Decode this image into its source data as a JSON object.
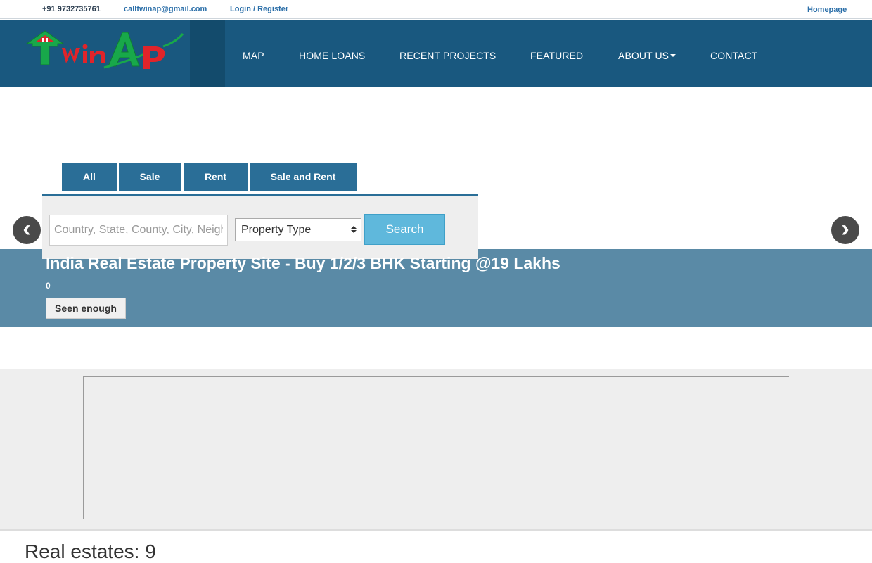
{
  "topbar": {
    "phone": "+91 9732735761",
    "email": "calltwinap@gmail.com",
    "login": "Login / Register",
    "homepage": "Homepage"
  },
  "logo": {
    "text": "TwinAp"
  },
  "nav": {
    "map": "MAP",
    "home_loans": "HOME LOANS",
    "recent_projects": "RECENT PROJECTS",
    "featured": "FEATURED",
    "about_us": "ABOUT US",
    "contact": "CONTACT"
  },
  "tabs": {
    "all": "All",
    "sale": "Sale",
    "rent": "Rent",
    "sale_and_rent": "Sale and Rent"
  },
  "search": {
    "placeholder": "Country, State, County, City, Neighborhood",
    "type_selected": "Property Type",
    "button": "Search"
  },
  "slider": {
    "prev": "‹",
    "next": "›",
    "title": "India Real Estate Property Site - Buy 1/2/3 BHK Starting @19 Lakhs",
    "count": "0",
    "seen_button": "Seen enough"
  },
  "listing": {
    "count_label": "Real estates: 9"
  },
  "colors": {
    "header": "#19587f",
    "tab": "#2a6e97",
    "search_button": "#5fb8dc",
    "band": "#5a8aa6"
  }
}
